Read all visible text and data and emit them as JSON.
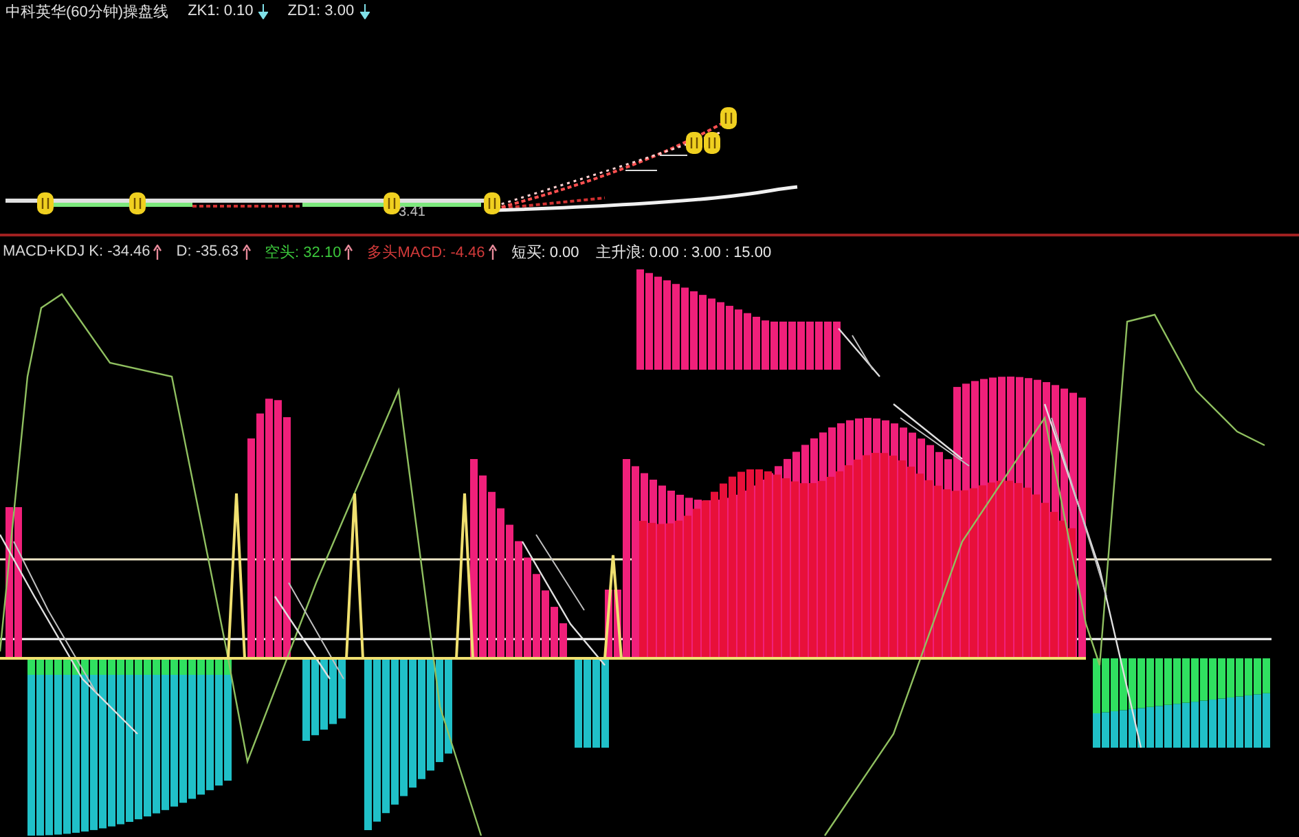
{
  "price_panel": {
    "title": "中科英华(60分钟)操盘线",
    "readouts": [
      {
        "label": "ZK1: 0.10"
      },
      {
        "label": "ZD1: 3.00"
      }
    ],
    "price_label": "3.41"
  },
  "indicator_panel": {
    "readouts": [
      {
        "label": "MACD+KDJ K: -34.46",
        "color": "#d8d8d8",
        "arrow": true
      },
      {
        "label": "D: -35.63",
        "color": "#d8d8d8",
        "arrow": true
      },
      {
        "label": "空头: 32.10",
        "color": "#3cc83c",
        "arrow": true
      },
      {
        "label": "多头MACD: -4.46",
        "color": "#d23a3a",
        "arrow": true
      },
      {
        "label": "短买: 0.00",
        "color": "#e8e8e8",
        "arrow": false
      },
      {
        "label": "主升浪: 0.00 : 3.00 : 15.00",
        "color": "#e8e8e8",
        "arrow": false
      }
    ]
  }
}
